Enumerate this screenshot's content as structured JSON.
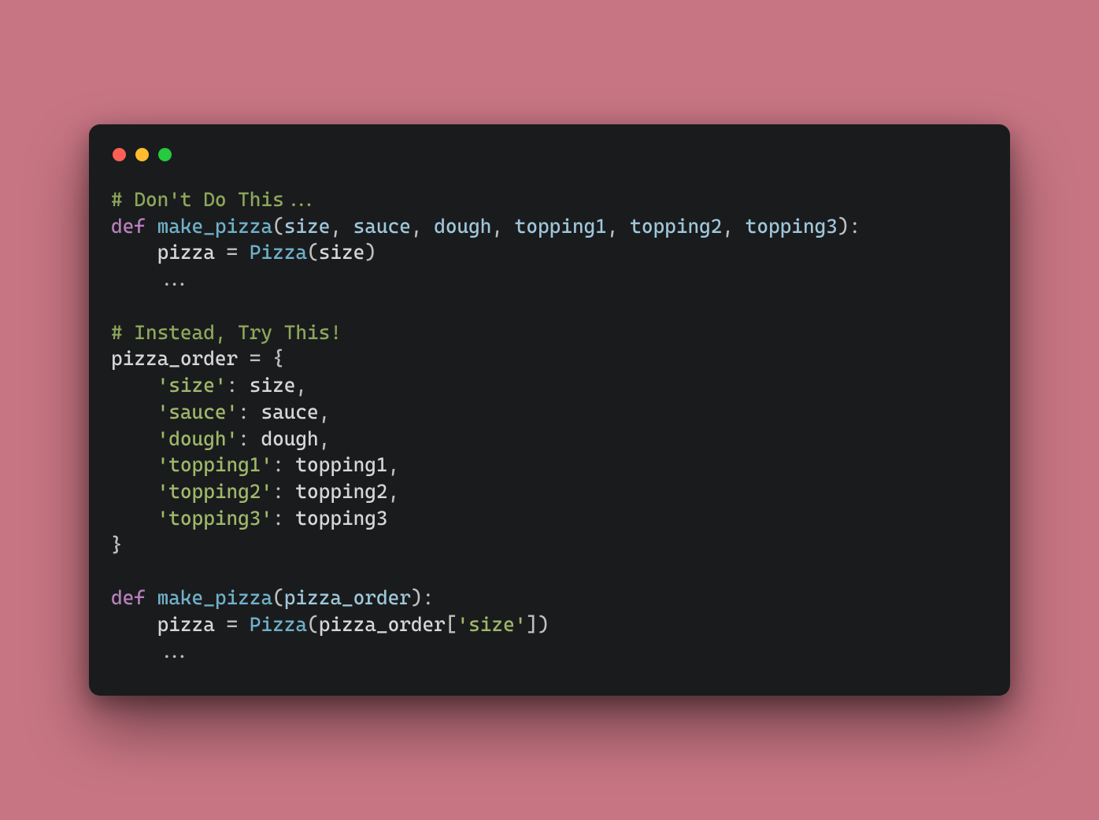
{
  "colors": {
    "background": "#c87583",
    "window_bg": "#1a1b1d",
    "traffic_red": "#ff5f56",
    "traffic_yellow": "#ffbd2e",
    "traffic_green": "#27c93f",
    "comment": "#8ea75b",
    "keyword": "#b77fbd",
    "function": "#6fb1c9",
    "param": "#9fc7db",
    "string": "#9fb86a",
    "punct": "#bfbfbf",
    "default_text": "#d7d7d7"
  },
  "code": {
    "lines": [
      [
        {
          "t": "comment",
          "v": "# Don't Do This..."
        }
      ],
      [
        {
          "t": "keyword",
          "v": "def"
        },
        {
          "t": "punct",
          "v": " "
        },
        {
          "t": "func",
          "v": "make_pizza"
        },
        {
          "t": "punct",
          "v": "("
        },
        {
          "t": "param",
          "v": "size"
        },
        {
          "t": "punct",
          "v": ", "
        },
        {
          "t": "param",
          "v": "sauce"
        },
        {
          "t": "punct",
          "v": ", "
        },
        {
          "t": "param",
          "v": "dough"
        },
        {
          "t": "punct",
          "v": ", "
        },
        {
          "t": "param",
          "v": "topping1"
        },
        {
          "t": "punct",
          "v": ", "
        },
        {
          "t": "param",
          "v": "topping2"
        },
        {
          "t": "punct",
          "v": ", "
        },
        {
          "t": "param",
          "v": "topping3"
        },
        {
          "t": "punct",
          "v": "):"
        }
      ],
      [
        {
          "t": "var",
          "v": "    pizza "
        },
        {
          "t": "punct",
          "v": "= "
        },
        {
          "t": "class",
          "v": "Pizza"
        },
        {
          "t": "punct",
          "v": "("
        },
        {
          "t": "var",
          "v": "size"
        },
        {
          "t": "punct",
          "v": ")"
        }
      ],
      [
        {
          "t": "punct",
          "v": "    ..."
        }
      ],
      [
        {
          "t": "punct",
          "v": ""
        }
      ],
      [
        {
          "t": "comment",
          "v": "# Instead, Try This!"
        }
      ],
      [
        {
          "t": "var",
          "v": "pizza_order "
        },
        {
          "t": "punct",
          "v": "= {"
        }
      ],
      [
        {
          "t": "punct",
          "v": "    "
        },
        {
          "t": "string",
          "v": "'size'"
        },
        {
          "t": "punct",
          "v": ": "
        },
        {
          "t": "var",
          "v": "size"
        },
        {
          "t": "punct",
          "v": ","
        }
      ],
      [
        {
          "t": "punct",
          "v": "    "
        },
        {
          "t": "string",
          "v": "'sauce'"
        },
        {
          "t": "punct",
          "v": ": "
        },
        {
          "t": "var",
          "v": "sauce"
        },
        {
          "t": "punct",
          "v": ","
        }
      ],
      [
        {
          "t": "punct",
          "v": "    "
        },
        {
          "t": "string",
          "v": "'dough'"
        },
        {
          "t": "punct",
          "v": ": "
        },
        {
          "t": "var",
          "v": "dough"
        },
        {
          "t": "punct",
          "v": ","
        }
      ],
      [
        {
          "t": "punct",
          "v": "    "
        },
        {
          "t": "string",
          "v": "'topping1'"
        },
        {
          "t": "punct",
          "v": ": "
        },
        {
          "t": "var",
          "v": "topping1"
        },
        {
          "t": "punct",
          "v": ","
        }
      ],
      [
        {
          "t": "punct",
          "v": "    "
        },
        {
          "t": "string",
          "v": "'topping2'"
        },
        {
          "t": "punct",
          "v": ": "
        },
        {
          "t": "var",
          "v": "topping2"
        },
        {
          "t": "punct",
          "v": ","
        }
      ],
      [
        {
          "t": "punct",
          "v": "    "
        },
        {
          "t": "string",
          "v": "'topping3'"
        },
        {
          "t": "punct",
          "v": ": "
        },
        {
          "t": "var",
          "v": "topping3"
        }
      ],
      [
        {
          "t": "punct",
          "v": "}"
        }
      ],
      [
        {
          "t": "punct",
          "v": ""
        }
      ],
      [
        {
          "t": "keyword",
          "v": "def"
        },
        {
          "t": "punct",
          "v": " "
        },
        {
          "t": "func",
          "v": "make_pizza"
        },
        {
          "t": "punct",
          "v": "("
        },
        {
          "t": "param",
          "v": "pizza_order"
        },
        {
          "t": "punct",
          "v": "):"
        }
      ],
      [
        {
          "t": "var",
          "v": "    pizza "
        },
        {
          "t": "punct",
          "v": "= "
        },
        {
          "t": "class",
          "v": "Pizza"
        },
        {
          "t": "punct",
          "v": "("
        },
        {
          "t": "var",
          "v": "pizza_order"
        },
        {
          "t": "punct",
          "v": "["
        },
        {
          "t": "string",
          "v": "'size'"
        },
        {
          "t": "punct",
          "v": "])"
        }
      ],
      [
        {
          "t": "punct",
          "v": "    ..."
        }
      ]
    ]
  }
}
